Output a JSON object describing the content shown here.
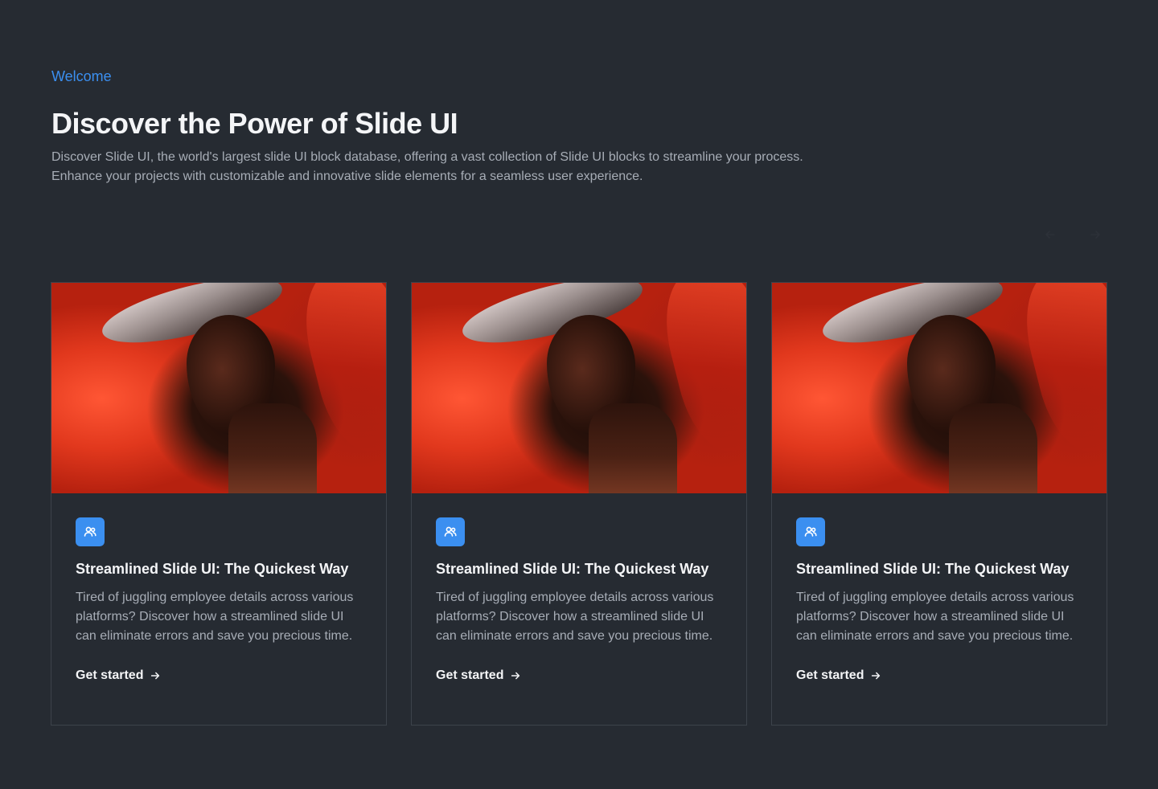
{
  "hero": {
    "eyebrow": "Welcome",
    "title": "Discover the Power of Slide UI",
    "description": "Discover Slide UI, the world's largest slide UI block database, offering a vast collection of Slide UI blocks to streamline your process. Enhance your projects with customizable and innovative slide elements for a seamless user experience."
  },
  "carousel": {
    "prev_icon": "arrow-left-icon",
    "next_icon": "arrow-right-icon"
  },
  "cards": [
    {
      "icon": "users-icon",
      "title": "Streamlined Slide UI: The Quickest Way",
      "text": "Tired of juggling employee details across various platforms? Discover how a streamlined slide UI can eliminate errors and save you precious time.",
      "link_label": "Get started",
      "link_icon": "arrow-right-icon"
    },
    {
      "icon": "users-icon",
      "title": "Streamlined Slide UI: The Quickest Way",
      "text": "Tired of juggling employee details across various platforms? Discover how a streamlined slide UI can eliminate errors and save you precious time.",
      "link_label": "Get started",
      "link_icon": "arrow-right-icon"
    },
    {
      "icon": "users-icon",
      "title": "Streamlined Slide UI: The Quickest Way",
      "text": "Tired of juggling employee details across various platforms? Discover how a streamlined slide UI can eliminate errors and save you precious time.",
      "link_label": "Get started",
      "link_icon": "arrow-right-icon"
    }
  ],
  "colors": {
    "background": "#262b32",
    "accent": "#3b8ff0",
    "card_border": "#3d434b",
    "muted_text": "#a7adb6"
  }
}
